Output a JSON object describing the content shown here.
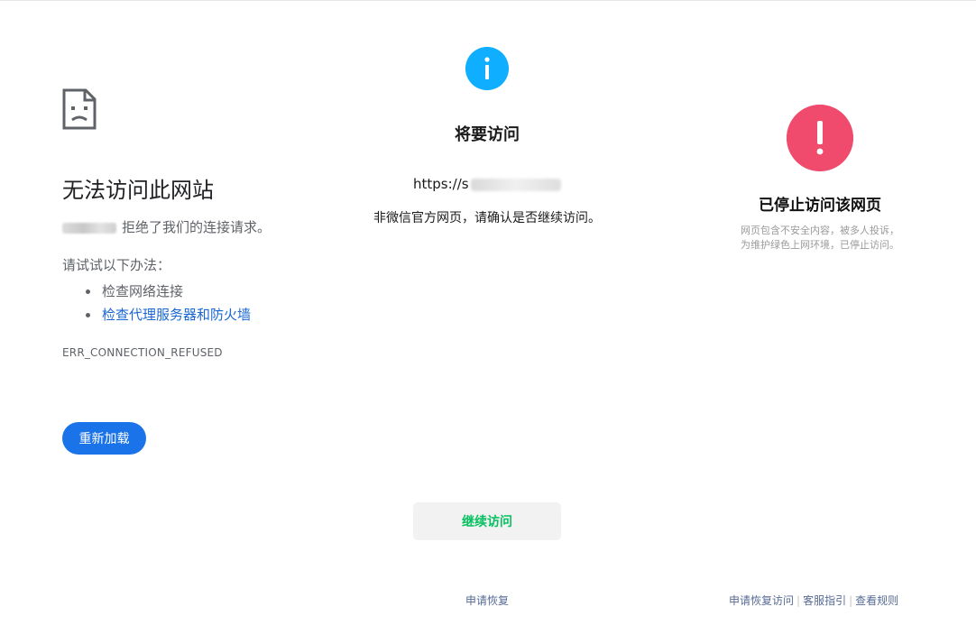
{
  "chrome_error": {
    "title": "无法访问此网站",
    "refused_message": "拒绝了我们的连接请求。",
    "try_label": "请试试以下办法：",
    "suggestions": [
      {
        "label": "检查网络连接",
        "is_link": false
      },
      {
        "label": "检查代理服务器和防火墙",
        "is_link": true
      }
    ],
    "error_code": "ERR_CONNECTION_REFUSED",
    "reload_label": "重新加载",
    "icon": "sad-document-icon"
  },
  "wechat_warning": {
    "icon": "info-icon",
    "title": "将要访问",
    "url_prefix": "https://s",
    "description": "非微信官方网页，请确认是否继续访问。",
    "continue_label": "继续访问",
    "appeal_label": "申请恢复",
    "accent_color": "#10aeff",
    "button_text_color": "#07c160"
  },
  "blocked_page": {
    "icon": "exclamation-icon",
    "title": "已停止访问该网页",
    "description_line1": "网页包含不安全内容，被多人投诉，",
    "description_line2": "为维护绿色上网环境，已停止访问。",
    "icon_color": "#f04a6c",
    "footer_links": [
      "申请恢复访问",
      "客服指引",
      "查看规则"
    ]
  }
}
